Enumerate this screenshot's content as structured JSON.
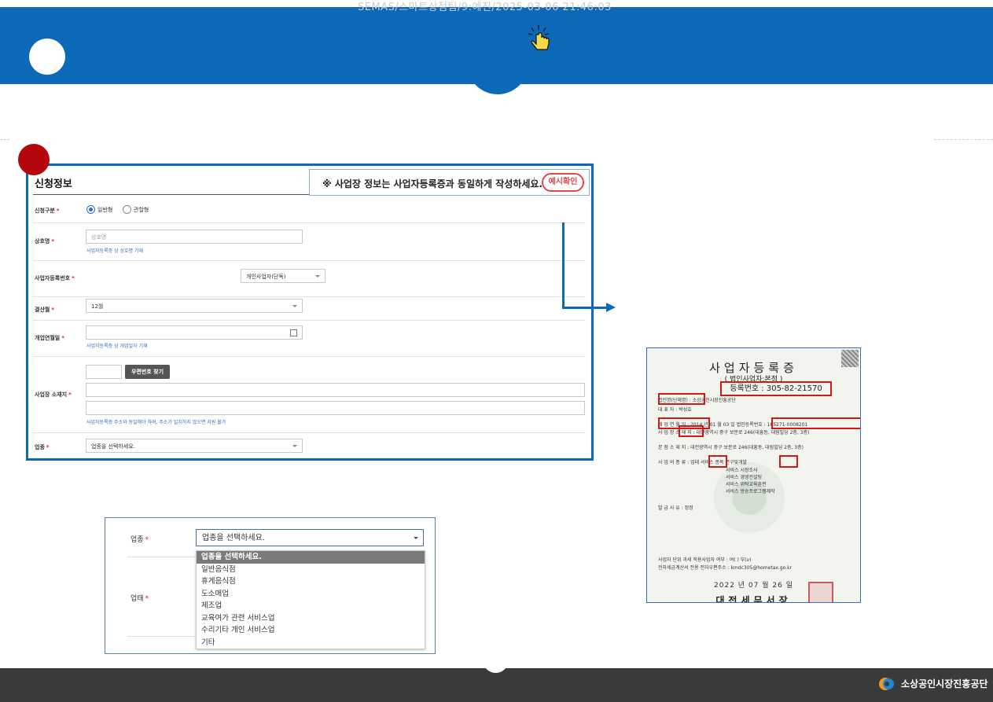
{
  "watermark": "SEMAS/스마트상점팀/9:예진/2025-03-06 21:46:03",
  "form": {
    "title": "신청정보",
    "notice": "※ 사업장 정보는 사업자등록증과 동일하게 작성하세요.",
    "example_button": "예시확인",
    "required_mark": "*",
    "rows": {
      "type": {
        "label": "신청구분",
        "options": [
          "일반형",
          "관할형"
        ],
        "selected": "일반형"
      },
      "name": {
        "label": "상호명",
        "placeholder": "상호명",
        "hint": "사업자등록증 상 상호명 기재"
      },
      "bizno": {
        "label": "사업자등록번호",
        "type_value": "개인사업자(단독)"
      },
      "month": {
        "label": "결산월",
        "value": "12월"
      },
      "opendate": {
        "label": "개업연월일",
        "hint": "사업자등록증 상 개업일자 기재"
      },
      "address": {
        "label": "사업장 소재지",
        "zip_button": "우편번호 찾기",
        "hint": "사업자등록증 주소와 동일해야 하며, 주소가 일치하지 않으면 지원 불가"
      },
      "industry": {
        "label": "업종",
        "value": "업종을 선택하세요."
      }
    }
  },
  "dropdown_demo": {
    "label_industry": "업종",
    "label_category": "업태",
    "selected": "업종을 선택하세요.",
    "options": [
      "업종을 선택하세요.",
      "일반음식점",
      "휴게음식점",
      "도소매업",
      "제조업",
      "교육여가 관련 서비스업",
      "수리기타 개인 서비스업",
      "기타"
    ]
  },
  "certificate": {
    "title": "사업자등록증",
    "subtitle": "( 법인사업자:본점 )",
    "reg_no": "등록번호 : 305-82-21570",
    "lines": [
      "법인명(단체명) : 소상공인시장진흥공단",
      "대 표 자 : 박성효",
      "개 업 연 월 일 : 2014 년 01 월 03 일     법인등록번호 : 165271-0008201",
      "사 업 장 소 재 지 : 대전광역시 중구 보문로 246(대흥동, 대림빌딩 2층, 3층)",
      "본 점 소 재 지 : 대전광역시 중구 보문로 246(대흥동, 대림빌딩 2층, 3층)",
      "사 업 의 종 류 :  업태  서비스        종목  연구및개발",
      "서비스                          시장조사",
      "서비스                          경영컨설팅",
      "서비스                          위탁교육훈련",
      "서비스                          방송프로그램제작",
      "발 급 사 유 : 정정",
      "사업자 단위 과세 적용사업자 여부 : 여( ) 부(v)",
      "전자세금계산서 전용 전자우편주소 : kmdc305@hometax.go.kr"
    ],
    "issue_date": "2022 년 07 월 26 일",
    "office": "대전세무서장"
  },
  "footer": {
    "org": "소상공인시장진흥공단"
  },
  "colors": {
    "brand_blue": "#0b69b7",
    "step_red": "#b3060d",
    "highlight_red": "#d01a1a",
    "footer_bg": "#3a3a3a"
  }
}
